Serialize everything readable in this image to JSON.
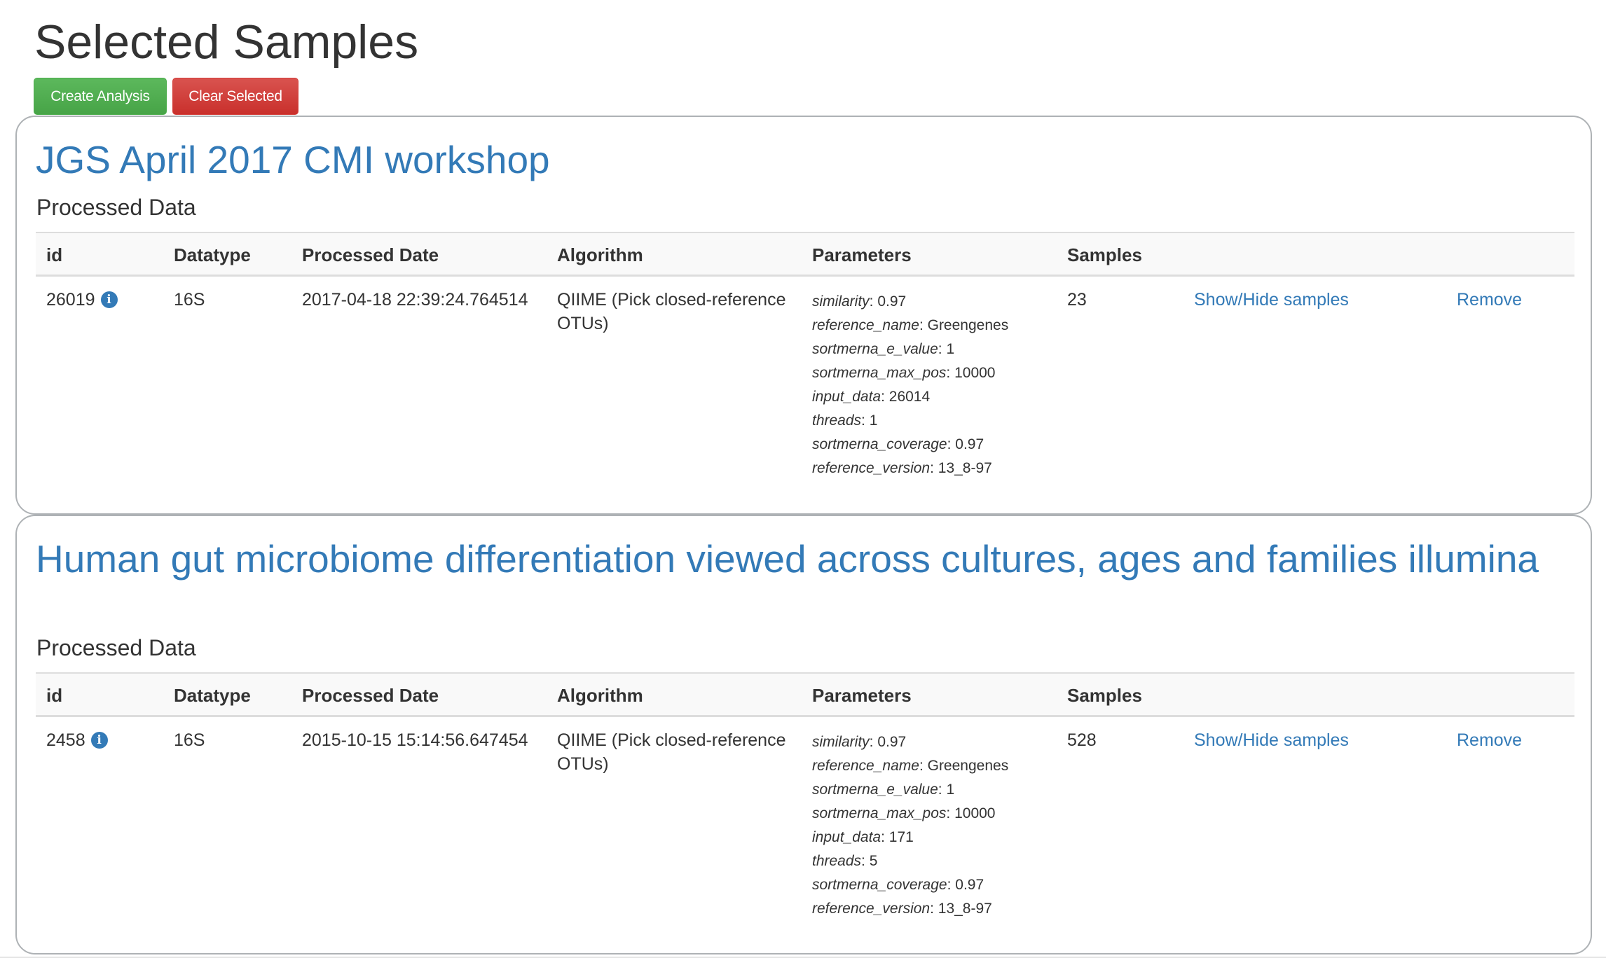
{
  "page": {
    "title": "Selected Samples"
  },
  "toolbar": {
    "create_label": "Create Analysis",
    "clear_label": "Clear Selected"
  },
  "table_headers": {
    "id": "id",
    "datatype": "Datatype",
    "processed_date": "Processed Date",
    "algorithm": "Algorithm",
    "parameters": "Parameters",
    "samples": "Samples"
  },
  "studies": [
    {
      "title": "JGS April 2017 CMI workshop",
      "section_title": "Processed Data",
      "row": {
        "id": "26019",
        "datatype": "16S",
        "processed_date": "2017-04-18 22:39:24.764514",
        "algorithm": "QIIME (Pick closed-reference OTUs)",
        "samples": "23",
        "show_hide_label": "Show/Hide samples",
        "remove_label": "Remove",
        "parameters": [
          {
            "key": "similarity",
            "value": "0.97"
          },
          {
            "key": "reference_name",
            "value": "Greengenes"
          },
          {
            "key": "sortmerna_e_value",
            "value": "1"
          },
          {
            "key": "sortmerna_max_pos",
            "value": "10000"
          },
          {
            "key": "input_data",
            "value": "26014"
          },
          {
            "key": "threads",
            "value": "1"
          },
          {
            "key": "sortmerna_coverage",
            "value": "0.97"
          },
          {
            "key": "reference_version",
            "value": "13_8-97"
          }
        ]
      }
    },
    {
      "title": "Human gut microbiome differentiation viewed across cultures, ages and families illumina",
      "section_title": "Processed Data",
      "row": {
        "id": "2458",
        "datatype": "16S",
        "processed_date": "2015-10-15 15:14:56.647454",
        "algorithm": "QIIME (Pick closed-reference OTUs)",
        "samples": "528",
        "show_hide_label": "Show/Hide samples",
        "remove_label": "Remove",
        "parameters": [
          {
            "key": "similarity",
            "value": "0.97"
          },
          {
            "key": "reference_name",
            "value": "Greengenes"
          },
          {
            "key": "sortmerna_e_value",
            "value": "1"
          },
          {
            "key": "sortmerna_max_pos",
            "value": "10000"
          },
          {
            "key": "input_data",
            "value": "171"
          },
          {
            "key": "threads",
            "value": "5"
          },
          {
            "key": "sortmerna_coverage",
            "value": "0.97"
          },
          {
            "key": "reference_version",
            "value": "13_8-97"
          }
        ]
      }
    }
  ],
  "icons": {
    "info": "info-circle-icon"
  },
  "colors": {
    "link": "#337ab7",
    "create_button": "#5cb85c",
    "clear_button": "#d9534f"
  }
}
